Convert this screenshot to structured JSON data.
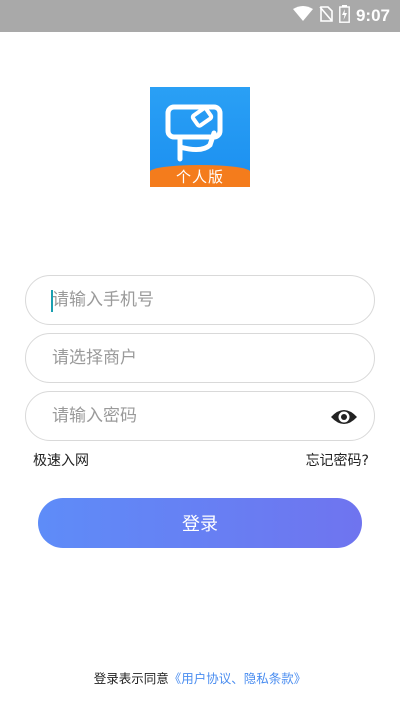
{
  "status_bar": {
    "time": "9:07",
    "icons": [
      "wifi-icon",
      "no-sim-icon",
      "battery-icon"
    ]
  },
  "logo": {
    "label": "个人版",
    "colors": {
      "bg": "#1b8ff0",
      "band": "#f47c1c"
    }
  },
  "form": {
    "phone_placeholder": "请输入手机号",
    "merchant_placeholder": "请选择商户",
    "password_placeholder": "请输入密码"
  },
  "links": {
    "quick_join": "极速入网",
    "forgot_password": "忘记密码?"
  },
  "login_button": "登录",
  "agreement": {
    "prefix": "登录表示同意",
    "link": "《用户协议、隐私条款》"
  },
  "colors": {
    "accent": "#4a8df0",
    "button_start": "#5e8cf8",
    "button_end": "#6f74ef"
  }
}
